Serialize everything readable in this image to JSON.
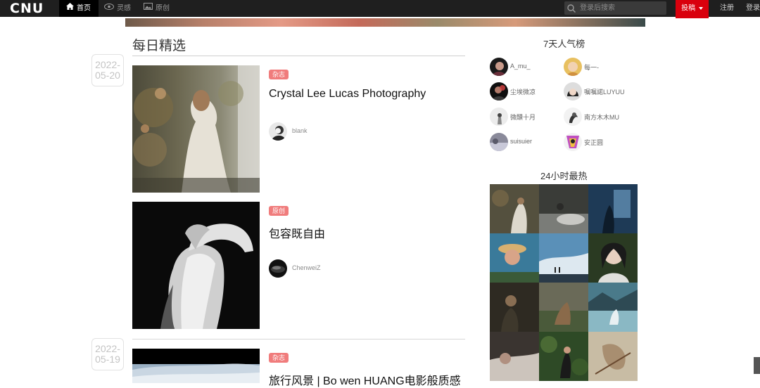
{
  "topbar": {
    "logo": "CNU",
    "nav": [
      {
        "label": "首页",
        "icon": "home-icon",
        "active": true
      },
      {
        "label": "灵感",
        "icon": "eye-icon",
        "active": false
      },
      {
        "label": "原创",
        "icon": "image-icon",
        "active": false
      }
    ],
    "search_placeholder": "登录后搜索",
    "submit_label": "投稿",
    "register_label": "注册",
    "login_label": "登录"
  },
  "main": {
    "section_title": "每日精选",
    "dates": [
      {
        "year": "2022-",
        "md": "05-20"
      },
      {
        "year": "2022-",
        "md": "05-19"
      }
    ],
    "posts": [
      {
        "tag": "杂志",
        "title": "Crystal Lee Lucas Photography",
        "author": "blank"
      },
      {
        "tag": "原创",
        "title": "包容既自由",
        "author": "ChenweiZ"
      },
      {
        "tag": "杂志",
        "title": "旅行风景 | Bo wen HUANG电影般质感",
        "author": ""
      }
    ]
  },
  "sidebar": {
    "rank_title": "7天人气榜",
    "rank_users": [
      "A_mu_",
      "每一-",
      "尘埃微凉",
      "嘱嘱諾LUYUU",
      "微醺十月",
      "南方木木MU",
      "suisuier",
      "安正圆"
    ],
    "hot_title": "24小时最热"
  },
  "colors": {
    "topbar_bg": "#1f1f1f",
    "submit_bg": "#d9000d",
    "tag_bg": "#f07c7c"
  }
}
